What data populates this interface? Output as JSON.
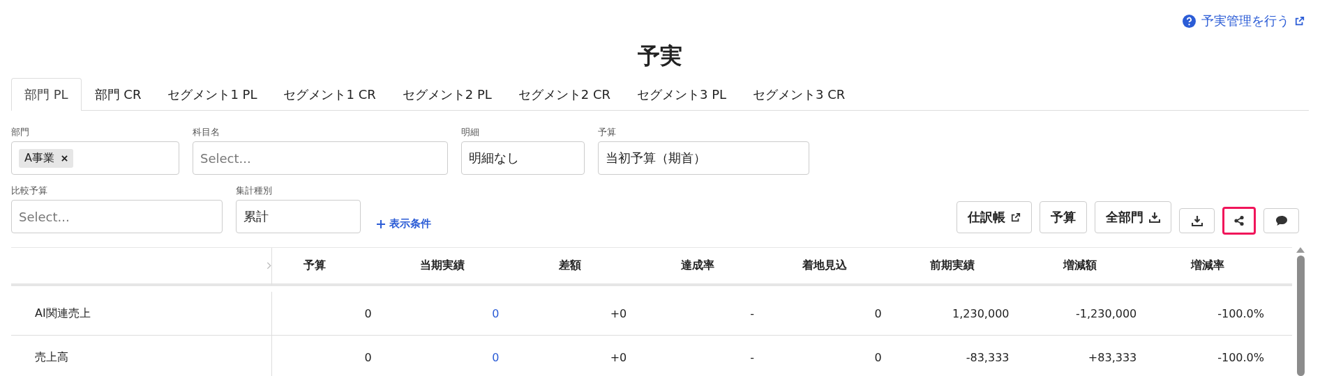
{
  "help_link": {
    "label": "予実管理を行う"
  },
  "title": "予実",
  "tabs": [
    {
      "label": "部門 PL",
      "selected": true
    },
    {
      "label": "部門 CR",
      "selected": false
    },
    {
      "label": "セグメント1 PL",
      "selected": false
    },
    {
      "label": "セグメント1 CR",
      "selected": false
    },
    {
      "label": "セグメント2 PL",
      "selected": false
    },
    {
      "label": "セグメント2 CR",
      "selected": false
    },
    {
      "label": "セグメント3 PL",
      "selected": false
    },
    {
      "label": "セグメント3 CR",
      "selected": false
    }
  ],
  "filters": [
    [
      {
        "label": "部門",
        "kind": "tags",
        "tags": [
          "A事業"
        ]
      },
      {
        "label": "科目名",
        "kind": "select",
        "placeholder": "Select..."
      },
      {
        "label": "明細",
        "kind": "select",
        "value": "明細なし"
      },
      {
        "label": "予算",
        "kind": "select",
        "value": "当初予算（期首）"
      }
    ],
    [
      {
        "label": "比較予算",
        "kind": "select",
        "placeholder": "Select..."
      },
      {
        "label": "集計種別",
        "kind": "select",
        "value": "累計"
      }
    ]
  ],
  "add_condition_link": "表示条件",
  "toolbar": [
    {
      "kind": "text",
      "label": "仕訳帳",
      "highlighted": false
    },
    {
      "kind": "text",
      "label": "予算",
      "highlighted": false
    },
    {
      "kind": "text",
      "label": "全部門",
      "highlighted": false
    },
    {
      "kind": "icon",
      "highlighted": false
    },
    {
      "kind": "icon",
      "highlighted": true
    },
    {
      "kind": "icon",
      "highlighted": false
    }
  ],
  "table": {
    "columns": [
      "予算",
      "当期実績",
      "差額",
      "達成率",
      "着地見込",
      "前期実績",
      "増減額",
      "増減率"
    ],
    "rows": [
      {
        "label": "AI関連売上",
        "cells": [
          {
            "text": "0",
            "link": false
          },
          {
            "text": "0",
            "link": true
          },
          {
            "text": "+0",
            "link": false
          },
          {
            "text": "-",
            "link": false
          },
          {
            "text": "0",
            "link": false
          },
          {
            "text": "1,230,000",
            "link": false
          },
          {
            "text": "-1,230,000",
            "link": false
          },
          {
            "text": "-100.0%",
            "link": false
          }
        ]
      },
      {
        "label": "売上高",
        "cells": [
          {
            "text": "0",
            "link": false
          },
          {
            "text": "0",
            "link": true
          },
          {
            "text": "+0",
            "link": false
          },
          {
            "text": "-",
            "link": false
          },
          {
            "text": "0",
            "link": false
          },
          {
            "text": "-83,333",
            "link": false
          },
          {
            "text": "+83,333",
            "link": false
          },
          {
            "text": "-100.0%",
            "link": false
          }
        ]
      }
    ]
  }
}
